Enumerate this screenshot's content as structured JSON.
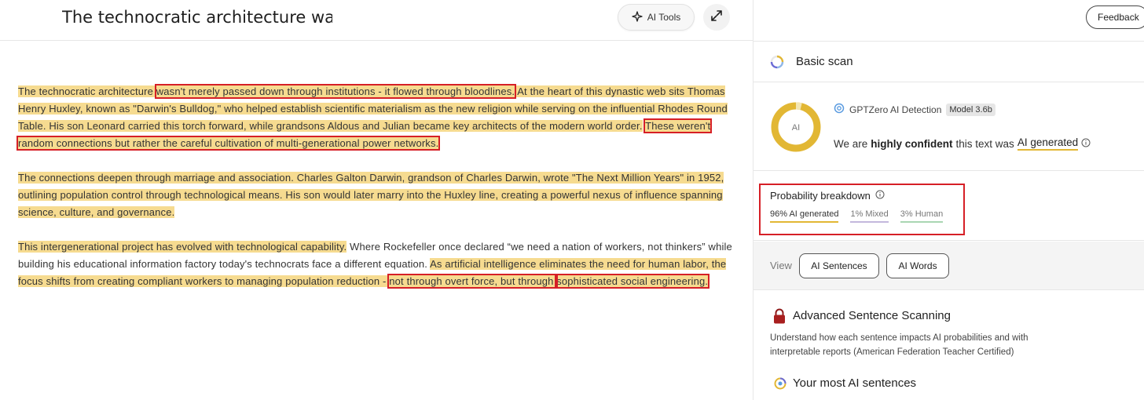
{
  "editor": {
    "title": "The technocratic architecture wa",
    "ai_tools_label": "AI Tools",
    "paragraphs": [
      {
        "segments": [
          "The technocratic architecture ",
          "wasn't merely passed down through institutions - it flowed through bloodlines.",
          " At the heart of this dynastic web sits Thomas Henry Huxley, known as \"Darwin's Bulldog,\" who helped establish scientific materialism as the new religion while serving on the influential Rhodes Round Table.",
          " His son Leonard carried this torch forward, while grandsons Aldous and Julian became key architects of the modern world order.",
          " ",
          "These weren't random connections but rather the careful cultivation of multi-generational power networks."
        ]
      },
      {
        "segments": [
          "The connections deepen through marriage and association.",
          " Charles Galton Darwin, grandson of Charles Darwin, wrote \"The Next Million Years\" in 1952, outlining population control through technological means.",
          " His son would later marry into the Huxley line, creating a powerful nexus of influence spanning science, culture, and governance."
        ]
      },
      {
        "segments": [
          "This intergenerational project has evolved with technological capability.",
          " Where Rockefeller once declared “we need a nation of workers, not thinkers” while building his educational information factory today's technocrats face a different equation. ",
          "As artificial intelligence eliminates the need for human labor, the focus shifts from creating compliant workers to managing population reduction - ",
          "not through overt force, but through ",
          "sophisticated social engineering."
        ]
      }
    ]
  },
  "panel": {
    "feedback_label": "Feedback",
    "basic_scan_label": "Basic scan",
    "donut_label": "AI",
    "detector_name": "GPTZero AI Detection",
    "model_badge": "Model 3.6b",
    "verdict_prefix": "We are",
    "verdict_strong": "highly confident",
    "verdict_middle": "this text was",
    "verdict_result": "AI generated",
    "prob_title": "Probability breakdown",
    "prob_ai": "96% AI generated",
    "prob_mixed": "1% Mixed",
    "prob_human": "3% Human",
    "view_label": "View",
    "view_sentences": "AI Sentences",
    "view_words": "AI Words",
    "adv_title": "Advanced Sentence Scanning",
    "adv_desc": "Understand how each sentence impacts AI probabilities and with interpretable reports (American Federation Teacher Certified)",
    "most_title": "Your most AI sentences"
  },
  "colors": {
    "highlight": "#f6db90",
    "annotation_box": "#d61f26",
    "ai_accent": "#e2b734",
    "mixed_accent": "#c3b8dc",
    "human_accent": "#a9d6b2"
  }
}
